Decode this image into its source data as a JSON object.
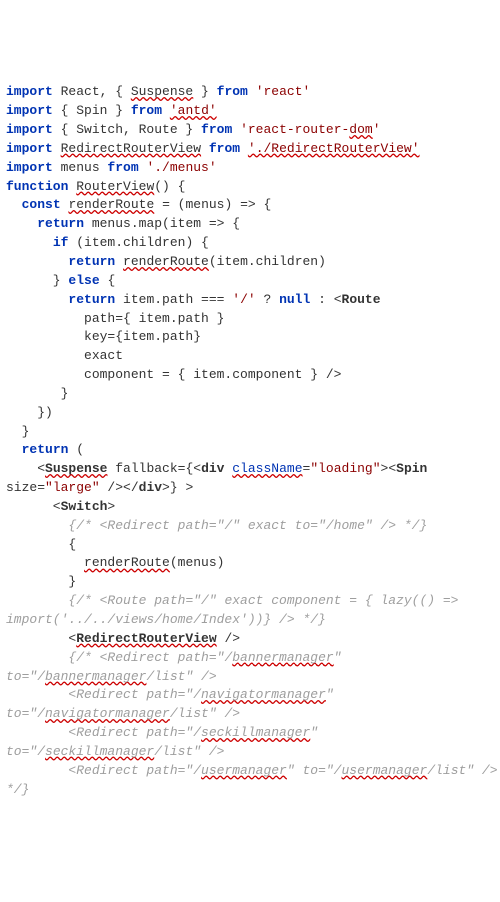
{
  "code": {
    "lines": [
      {
        "parts": [
          {
            "cls": "kw",
            "t": "import"
          },
          {
            "cls": "id",
            "t": " React, { "
          },
          {
            "cls": "id squig",
            "t": "Suspense"
          },
          {
            "cls": "id",
            "t": " } "
          },
          {
            "cls": "kw",
            "t": "from"
          },
          {
            "cls": "id",
            "t": " "
          },
          {
            "cls": "str",
            "t": "'react'"
          }
        ]
      },
      {
        "parts": [
          {
            "cls": "kw",
            "t": "import"
          },
          {
            "cls": "id",
            "t": " { Spin } "
          },
          {
            "cls": "kw",
            "t": "from"
          },
          {
            "cls": "id",
            "t": " "
          },
          {
            "cls": "str squig",
            "t": "'antd'"
          }
        ]
      },
      {
        "parts": [
          {
            "cls": "kw",
            "t": "import"
          },
          {
            "cls": "id",
            "t": " { Switch, Route } "
          },
          {
            "cls": "kw",
            "t": "from"
          },
          {
            "cls": "id",
            "t": " "
          },
          {
            "cls": "str",
            "t": "'react-router-"
          },
          {
            "cls": "str squig",
            "t": "dom"
          },
          {
            "cls": "str",
            "t": "'"
          }
        ]
      },
      {
        "parts": [
          {
            "cls": "kw",
            "t": "import"
          },
          {
            "cls": "id",
            "t": " "
          },
          {
            "cls": "id squig",
            "t": "RedirectRouterView"
          },
          {
            "cls": "id",
            "t": " "
          },
          {
            "cls": "kw",
            "t": "from"
          },
          {
            "cls": "id",
            "t": " "
          },
          {
            "cls": "str squig",
            "t": "'./RedirectRouterView'"
          }
        ]
      },
      {
        "parts": [
          {
            "cls": "kw",
            "t": "import"
          },
          {
            "cls": "id",
            "t": " menus "
          },
          {
            "cls": "kw",
            "t": "from"
          },
          {
            "cls": "id",
            "t": " "
          },
          {
            "cls": "str",
            "t": "'./menus'"
          }
        ]
      },
      {
        "parts": [
          {
            "cls": "kw",
            "t": "function"
          },
          {
            "cls": "id",
            "t": " "
          },
          {
            "cls": "id squig",
            "t": "RouterView"
          },
          {
            "cls": "id",
            "t": "() {"
          }
        ]
      },
      {
        "parts": [
          {
            "cls": "id",
            "t": "  "
          },
          {
            "cls": "kw",
            "t": "const"
          },
          {
            "cls": "id",
            "t": " "
          },
          {
            "cls": "id squig",
            "t": "renderRoute"
          },
          {
            "cls": "id",
            "t": " = (menus) => {"
          }
        ]
      },
      {
        "parts": [
          {
            "cls": "id",
            "t": "    "
          },
          {
            "cls": "kw",
            "t": "return"
          },
          {
            "cls": "id",
            "t": " menus.map(item => {"
          }
        ]
      },
      {
        "parts": [
          {
            "cls": "id",
            "t": "      "
          },
          {
            "cls": "kw",
            "t": "if"
          },
          {
            "cls": "id",
            "t": " (item.children) {"
          }
        ]
      },
      {
        "parts": [
          {
            "cls": "id",
            "t": "        "
          },
          {
            "cls": "kw",
            "t": "return"
          },
          {
            "cls": "id",
            "t": " "
          },
          {
            "cls": "id squig",
            "t": "renderRoute"
          },
          {
            "cls": "id",
            "t": "(item.children)"
          }
        ]
      },
      {
        "parts": [
          {
            "cls": "id",
            "t": "      } "
          },
          {
            "cls": "kw",
            "t": "else"
          },
          {
            "cls": "id",
            "t": " {"
          }
        ]
      },
      {
        "parts": [
          {
            "cls": "id",
            "t": "        "
          },
          {
            "cls": "kw",
            "t": "return"
          },
          {
            "cls": "id",
            "t": " item.path === "
          },
          {
            "cls": "str",
            "t": "'/'"
          },
          {
            "cls": "id",
            "t": " ? "
          },
          {
            "cls": "kw",
            "t": "null"
          },
          {
            "cls": "id",
            "t": " : <"
          },
          {
            "cls": "tag",
            "t": "Route"
          }
        ]
      },
      {
        "parts": [
          {
            "cls": "id",
            "t": "          path={ item.path }"
          }
        ]
      },
      {
        "parts": [
          {
            "cls": "id",
            "t": "          key={item.path}"
          }
        ]
      },
      {
        "parts": [
          {
            "cls": "id",
            "t": "          exact"
          }
        ]
      },
      {
        "parts": [
          {
            "cls": "id",
            "t": "          component = { item.component } />"
          }
        ]
      },
      {
        "parts": [
          {
            "cls": "id",
            "t": "       }"
          }
        ]
      },
      {
        "parts": [
          {
            "cls": "id",
            "t": "    })"
          }
        ]
      },
      {
        "parts": [
          {
            "cls": "id",
            "t": "  }"
          }
        ]
      },
      {
        "parts": [
          {
            "cls": "id",
            "t": "  "
          },
          {
            "cls": "kw",
            "t": "return"
          },
          {
            "cls": "id",
            "t": " ("
          }
        ]
      },
      {
        "parts": [
          {
            "cls": "id",
            "t": "    <"
          },
          {
            "cls": "tag squig",
            "t": "Suspense"
          },
          {
            "cls": "id",
            "t": " fallback={<"
          },
          {
            "cls": "tag",
            "t": "div"
          },
          {
            "cls": "id",
            "t": " "
          },
          {
            "cls": "attr squig",
            "t": "className"
          },
          {
            "cls": "id",
            "t": "="
          },
          {
            "cls": "str",
            "t": "\"loading\""
          },
          {
            "cls": "id",
            "t": "><"
          },
          {
            "cls": "tag",
            "t": "Spin"
          },
          {
            "cls": "id",
            "t": " "
          }
        ]
      },
      {
        "parts": [
          {
            "cls": "id",
            "t": "size="
          },
          {
            "cls": "str",
            "t": "\"large\""
          },
          {
            "cls": "id",
            "t": " />"
          },
          {
            "cls": "id",
            "t": "</"
          },
          {
            "cls": "tag",
            "t": "div"
          },
          {
            "cls": "id",
            "t": ">} >"
          }
        ]
      },
      {
        "parts": [
          {
            "cls": "id",
            "t": "      <"
          },
          {
            "cls": "tag",
            "t": "Switch"
          },
          {
            "cls": "id",
            "t": ">"
          }
        ]
      },
      {
        "parts": [
          {
            "cls": "id",
            "t": "        "
          },
          {
            "cls": "comment",
            "t": "{/* <Redirect path=\"/\" exact to=\"/home\" /> */}"
          }
        ]
      },
      {
        "parts": [
          {
            "cls": "id",
            "t": "        {"
          }
        ]
      },
      {
        "parts": [
          {
            "cls": "id",
            "t": "          "
          },
          {
            "cls": "id squig",
            "t": "renderRoute"
          },
          {
            "cls": "id",
            "t": "(menus)"
          }
        ]
      },
      {
        "parts": [
          {
            "cls": "id",
            "t": "        }"
          }
        ]
      },
      {
        "parts": [
          {
            "cls": "id",
            "t": "        "
          },
          {
            "cls": "comment",
            "t": "{/* <Route path=\"/\" exact component = { lazy(() =>"
          }
        ]
      },
      {
        "parts": [
          {
            "cls": "comment",
            "t": "import('../../views/home/Index'))} /> */}"
          }
        ]
      },
      {
        "parts": [
          {
            "cls": "id",
            "t": "        <"
          },
          {
            "cls": "tag squig",
            "t": "RedirectRouterView"
          },
          {
            "cls": "id",
            "t": " />"
          }
        ]
      },
      {
        "parts": [
          {
            "cls": "id",
            "t": "        "
          },
          {
            "cls": "comment",
            "t": "{/* <Redirect path=\"/"
          },
          {
            "cls": "comment squig",
            "t": "bannermanager"
          },
          {
            "cls": "comment",
            "t": "\" "
          }
        ]
      },
      {
        "parts": [
          {
            "cls": "comment",
            "t": "to=\"/"
          },
          {
            "cls": "comment squig",
            "t": "bannermanager"
          },
          {
            "cls": "comment",
            "t": "/list\" />"
          }
        ]
      },
      {
        "parts": [
          {
            "cls": "comment",
            "t": "        <Redirect path=\"/"
          },
          {
            "cls": "comment squig",
            "t": "navigatormanager"
          },
          {
            "cls": "comment",
            "t": "\" "
          }
        ]
      },
      {
        "parts": [
          {
            "cls": "comment",
            "t": "to=\"/"
          },
          {
            "cls": "comment squig",
            "t": "navigatormanager"
          },
          {
            "cls": "comment",
            "t": "/list\" />"
          }
        ]
      },
      {
        "parts": [
          {
            "cls": "comment",
            "t": "        <Redirect path=\"/"
          },
          {
            "cls": "comment squig",
            "t": "seckillmanager"
          },
          {
            "cls": "comment",
            "t": "\" "
          }
        ]
      },
      {
        "parts": [
          {
            "cls": "comment",
            "t": "to=\"/"
          },
          {
            "cls": "comment squig",
            "t": "seckillmanager"
          },
          {
            "cls": "comment",
            "t": "/list\" />"
          }
        ]
      },
      {
        "parts": [
          {
            "cls": "comment",
            "t": "        <Redirect path=\"/"
          },
          {
            "cls": "comment squig",
            "t": "usermanager"
          },
          {
            "cls": "comment",
            "t": "\" to=\"/"
          },
          {
            "cls": "comment squig",
            "t": "usermanager"
          },
          {
            "cls": "comment",
            "t": "/list\" /> "
          }
        ]
      },
      {
        "parts": [
          {
            "cls": "comment",
            "t": "*/}"
          }
        ]
      }
    ]
  }
}
